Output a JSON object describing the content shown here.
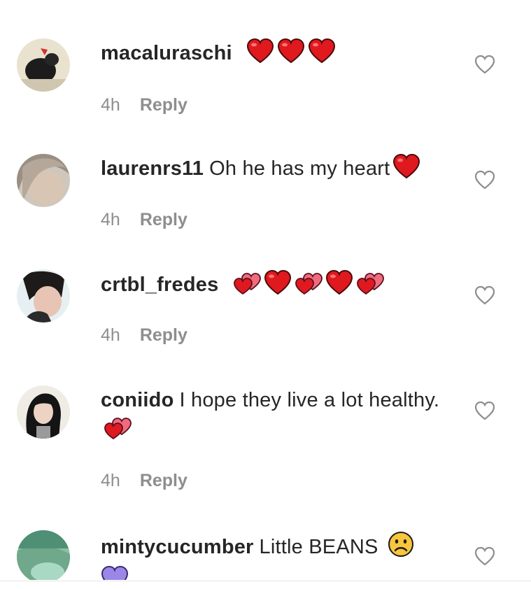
{
  "comments": [
    {
      "username": "macaluraschi",
      "text": "",
      "emojis": [
        "red-heart",
        "red-heart",
        "red-heart"
      ],
      "time": "4h",
      "reply_label": "Reply"
    },
    {
      "username": "laurenrs11",
      "text": "Oh he has my heart",
      "emojis": [
        "red-heart"
      ],
      "time": "4h",
      "reply_label": "Reply"
    },
    {
      "username": "crtbl_fredes",
      "text": "",
      "emojis": [
        "two-hearts",
        "red-heart",
        "two-hearts",
        "red-heart",
        "two-hearts"
      ],
      "time": "4h",
      "reply_label": "Reply"
    },
    {
      "username": "coniido",
      "text": "I hope they live a lot healthy.",
      "emojis": [
        "two-hearts"
      ],
      "time": "4h",
      "reply_label": "Reply"
    },
    {
      "username": "mintycucumber",
      "text": "Little BEANS",
      "emojis": [
        "slightly-frowning-face",
        "purple-heart"
      ],
      "time": "",
      "reply_label": ""
    }
  ],
  "colors": {
    "text": "#262626",
    "meta": "#8e8e8e",
    "heart_red": "#e0191f",
    "heart_pink": "#f06b7e",
    "purple_heart": "#9b87e8"
  }
}
